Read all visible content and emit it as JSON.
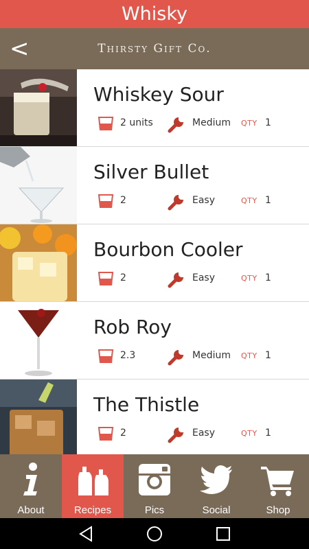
{
  "header": {
    "title": "Whisky"
  },
  "brand": {
    "name": "Thirsty Gift Co.",
    "back_label": "<"
  },
  "recipes": [
    {
      "name": "Whiskey Sour",
      "units": "2 units",
      "difficulty": "Medium",
      "qty_label": "QTY",
      "qty": "1"
    },
    {
      "name": "Silver Bullet",
      "units": "2",
      "difficulty": "Easy",
      "qty_label": "QTY",
      "qty": "1"
    },
    {
      "name": "Bourbon Cooler",
      "units": "2",
      "difficulty": "Easy",
      "qty_label": "QTY",
      "qty": "1"
    },
    {
      "name": "Rob Roy",
      "units": "2.3",
      "difficulty": "Medium",
      "qty_label": "QTY",
      "qty": "1"
    },
    {
      "name": "The Thistle",
      "units": "2",
      "difficulty": "Easy",
      "qty_label": "QTY",
      "qty": "1"
    }
  ],
  "tabs": [
    {
      "label": "About",
      "icon": "info-icon",
      "active": false
    },
    {
      "label": "Recipes",
      "icon": "bottles-icon",
      "active": true
    },
    {
      "label": "Pics",
      "icon": "instagram-icon",
      "active": false
    },
    {
      "label": "Social",
      "icon": "twitter-icon",
      "active": false
    },
    {
      "label": "Shop",
      "icon": "cart-icon",
      "active": false
    }
  ],
  "colors": {
    "accent": "#e2574c",
    "bar": "#7a6a58"
  }
}
